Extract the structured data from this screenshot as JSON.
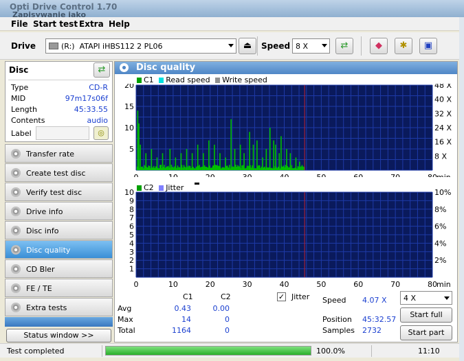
{
  "window": {
    "title": "Opti Drive Control 1.70",
    "subtitle": "Zapisywanie jako"
  },
  "menu": [
    "File",
    "Start test",
    "Extra",
    "Help"
  ],
  "toolbar": {
    "drive_label": "Drive",
    "drive_letter": "(R:)",
    "drive_name": "ATAPI iHBS112   2 PL06",
    "speed_label": "Speed",
    "speed_value": "8 X"
  },
  "disc": {
    "header": "Disc",
    "fields": [
      {
        "k": "Type",
        "v": "CD-R"
      },
      {
        "k": "MID",
        "v": "97m17s06f"
      },
      {
        "k": "Length",
        "v": "45:33.55"
      },
      {
        "k": "Contents",
        "v": "audio"
      },
      {
        "k": "Label",
        "v": ""
      }
    ]
  },
  "nav": [
    "Transfer rate",
    "Create test disc",
    "Verify test disc",
    "Drive info",
    "Disc info",
    "Disc quality",
    "CD Bler",
    "FE / TE",
    "Extra tests"
  ],
  "nav_selected": "Disc quality",
  "status_window_btn": "Status window >>",
  "panel_title": "Disc quality",
  "legend_top": {
    "c1": "C1",
    "read": "Read speed",
    "write": "Write speed"
  },
  "legend_bottom": {
    "c2": "C2",
    "jitter": "Jitter"
  },
  "chart_data": [
    {
      "type": "bar",
      "series": [
        {
          "name": "C1",
          "color": "#00c000"
        }
      ],
      "xlim": [
        0,
        80
      ],
      "xticks": [
        0,
        10,
        20,
        30,
        40,
        50,
        60,
        70,
        80
      ],
      "xunit": "min",
      "ylim": [
        0,
        20
      ],
      "yticks": [
        5,
        10,
        15,
        20
      ],
      "y2ticks": [
        "8 X",
        "16 X",
        "24 X",
        "32 X",
        "40 X",
        "48 X"
      ],
      "marker_x": 45.5,
      "peaks": [
        [
          0.3,
          14
        ],
        [
          0.6,
          11
        ],
        [
          1.0,
          6
        ],
        [
          2.5,
          4
        ],
        [
          4.0,
          5
        ],
        [
          5.5,
          3
        ],
        [
          7.0,
          4
        ],
        [
          9.0,
          5
        ],
        [
          10.5,
          3
        ],
        [
          12.0,
          4
        ],
        [
          13.5,
          5
        ],
        [
          15.0,
          4
        ],
        [
          16.5,
          6
        ],
        [
          18.0,
          4
        ],
        [
          19.5,
          7
        ],
        [
          21.0,
          6
        ],
        [
          22.5,
          4
        ],
        [
          24.0,
          3
        ],
        [
          25.5,
          12
        ],
        [
          26.5,
          5
        ],
        [
          28.0,
          6
        ],
        [
          29.0,
          4
        ],
        [
          30.5,
          9
        ],
        [
          31.5,
          6
        ],
        [
          32.5,
          7
        ],
        [
          34.0,
          3
        ],
        [
          35.0,
          5
        ],
        [
          36.0,
          10
        ],
        [
          37.0,
          7
        ],
        [
          37.5,
          6
        ],
        [
          38.5,
          4
        ],
        [
          39.0,
          8
        ],
        [
          40.5,
          5
        ],
        [
          41.5,
          4
        ],
        [
          43.0,
          3
        ],
        [
          44.0,
          2
        ]
      ],
      "baseline_max": 1.3
    },
    {
      "type": "bar",
      "series": [
        {
          "name": "C2",
          "color": "#00c000"
        }
      ],
      "xlim": [
        0,
        80
      ],
      "xticks": [
        0,
        10,
        20,
        30,
        40,
        50,
        60,
        70,
        80
      ],
      "xunit": "min",
      "ylim": [
        0,
        10
      ],
      "yticks": [
        1,
        2,
        3,
        4,
        5,
        6,
        7,
        8,
        9,
        10
      ],
      "y2ticks": [
        "2%",
        "4%",
        "6%",
        "8%",
        "10%"
      ],
      "marker_x": 45.5,
      "values": []
    }
  ],
  "stats": {
    "col_c1": "C1",
    "col_c2": "C2",
    "rows": [
      {
        "label": "Avg",
        "c1": "0.43",
        "c2": "0.00"
      },
      {
        "label": "Max",
        "c1": "14",
        "c2": "0"
      },
      {
        "label": "Total",
        "c1": "1164",
        "c2": "0"
      }
    ],
    "jitter_label": "Jitter",
    "speed_label": "Speed",
    "speed_value": "4.07 X",
    "position_label": "Position",
    "position_value": "45:32.57",
    "samples_label": "Samples",
    "samples_value": "2732",
    "speed_select": "4 X",
    "start_full": "Start full",
    "start_part": "Start part"
  },
  "status": {
    "text": "Test completed",
    "progress": 100.0,
    "progress_text": "100.0%",
    "time": "11:10"
  },
  "colors": {
    "plot_bg": "#0a1a5c",
    "grid": "#1e3aa8",
    "bar": "#00c000",
    "marker": "#c02030",
    "accent": "#3a8fd6"
  }
}
